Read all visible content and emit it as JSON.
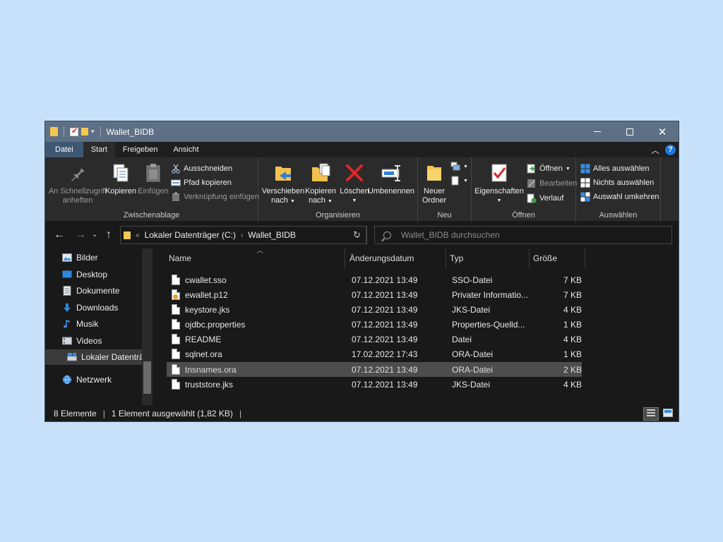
{
  "window": {
    "title": "Wallet_BIDB"
  },
  "tabs": [
    {
      "label": "Datei"
    },
    {
      "label": "Start"
    },
    {
      "label": "Freigeben"
    },
    {
      "label": "Ansicht"
    }
  ],
  "ribbon": {
    "clipboard": {
      "label": "Zwischenablage",
      "pin": "An Schnellzugriff anheften",
      "pin_line1": "An Schnellzugriff",
      "pin_line2": "anheften",
      "copy": "Kopieren",
      "paste": "Einfügen",
      "cut": "Ausschneiden",
      "copy_path": "Pfad kopieren",
      "paste_shortcut": "Verknüpfung einfügen"
    },
    "organize": {
      "label": "Organisieren",
      "move_line1": "Verschieben",
      "move_line2": "nach",
      "copyto_line1": "Kopieren",
      "copyto_line2": "nach",
      "delete": "Löschen",
      "rename": "Umbenennen"
    },
    "new": {
      "label": "Neu",
      "folder_line1": "Neuer",
      "folder_line2": "Ordner"
    },
    "open": {
      "label": "Öffnen",
      "properties": "Eigenschaften",
      "open": "Öffnen",
      "edit": "Bearbeiten",
      "history": "Verlauf"
    },
    "select": {
      "label": "Auswählen",
      "all": "Alles auswählen",
      "none": "Nichts auswählen",
      "invert": "Auswahl umkehren"
    }
  },
  "address": {
    "overflow": "«",
    "crumbs": [
      "Lokaler Datenträger (C:)",
      "Wallet_BIDB"
    ],
    "search_placeholder": "Wallet_BIDB durchsuchen"
  },
  "sidebar": {
    "items": [
      {
        "label": "Bilder",
        "icon": "pictures-icon"
      },
      {
        "label": "Desktop",
        "icon": "desktop-icon"
      },
      {
        "label": "Dokumente",
        "icon": "documents-icon"
      },
      {
        "label": "Downloads",
        "icon": "downloads-icon"
      },
      {
        "label": "Musik",
        "icon": "music-icon"
      },
      {
        "label": "Videos",
        "icon": "videos-icon"
      },
      {
        "label": "Lokaler Datenträger (C:)",
        "icon": "drive-icon"
      },
      {
        "label": "Netzwerk",
        "icon": "network-icon"
      }
    ]
  },
  "columns": {
    "name": "Name",
    "date": "Änderungsdatum",
    "type": "Typ",
    "size": "Größe"
  },
  "files": [
    {
      "name": "cwallet.sso",
      "date": "07.12.2021 13:49",
      "type": "SSO-Datei",
      "size": "7 KB"
    },
    {
      "name": "ewallet.p12",
      "date": "07.12.2021 13:49",
      "type": "Privater Informatio...",
      "size": "7 KB"
    },
    {
      "name": "keystore.jks",
      "date": "07.12.2021 13:49",
      "type": "JKS-Datei",
      "size": "4 KB"
    },
    {
      "name": "ojdbc.properties",
      "date": "07.12.2021 13:49",
      "type": "Properties-Quelld...",
      "size": "1 KB"
    },
    {
      "name": "README",
      "date": "07.12.2021 13:49",
      "type": "Datei",
      "size": "4 KB"
    },
    {
      "name": "sqlnet.ora",
      "date": "17.02.2022 17:43",
      "type": "ORA-Datei",
      "size": "1 KB"
    },
    {
      "name": "tnsnames.ora",
      "date": "07.12.2021 13:49",
      "type": "ORA-Datei",
      "size": "2 KB"
    },
    {
      "name": "truststore.jks",
      "date": "07.12.2021 13:49",
      "type": "JKS-Datei",
      "size": "4 KB"
    }
  ],
  "status": {
    "count": "8 Elemente",
    "selection": "1 Element ausgewählt (1,82 KB)"
  }
}
